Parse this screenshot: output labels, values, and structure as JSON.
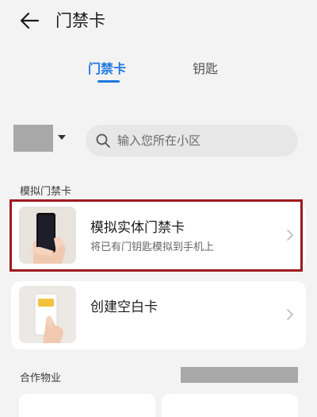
{
  "header": {
    "title": "门禁卡"
  },
  "tabs": [
    {
      "label": "门禁卡",
      "active": true
    },
    {
      "label": "钥匙",
      "active": false
    }
  ],
  "search": {
    "placeholder": "输入您所在小区"
  },
  "sections": {
    "simulated": "模拟门禁卡",
    "partners": "合作物业"
  },
  "cards": [
    {
      "title": "模拟实体门禁卡",
      "subtitle": "将已有门钥匙模拟到手机上",
      "icon": "phone-in-hand-icon",
      "highlighted": true
    },
    {
      "title": "创建空白卡",
      "icon": "blank-card-phone-icon",
      "highlighted": false
    }
  ],
  "colors": {
    "accent": "#1f78e0",
    "highlight": "#9d1b1f",
    "redacted": "#a8a8a8"
  },
  "icons": [
    "back-arrow-icon",
    "caret-down-icon",
    "search-icon",
    "chevron-right-icon"
  ]
}
